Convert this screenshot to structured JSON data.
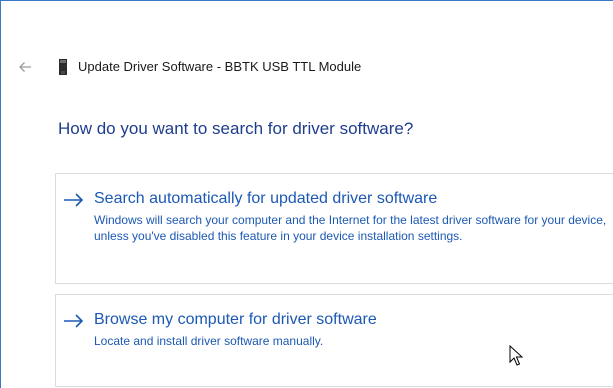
{
  "window": {
    "title": "Update Driver Software - BBTK USB TTL Module"
  },
  "icons": {
    "back": "back-arrow-icon",
    "device": "usb-device-icon",
    "option_arrow": "right-arrow-icon",
    "cursor": "mouse-pointer-icon"
  },
  "main": {
    "heading": "How do you want to search for driver software?",
    "options": [
      {
        "title": "Search automatically for updated driver software",
        "description": "Windows will search your computer and the Internet for the latest driver software for your device, unless you've disabled this feature in your device installation settings."
      },
      {
        "title": "Browse my computer for driver software",
        "description": "Locate and install driver software manually."
      }
    ]
  },
  "colors": {
    "heading": "#1e3d8f",
    "link": "#1c59b4",
    "border": "#dcdcdc",
    "window_edge": "#3c78c8"
  }
}
